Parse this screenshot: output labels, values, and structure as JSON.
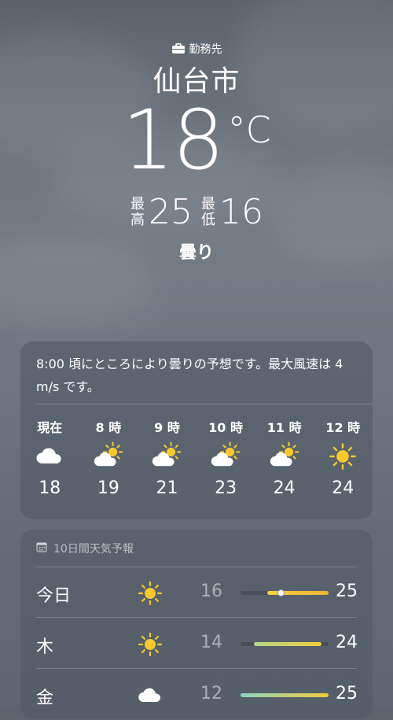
{
  "location": {
    "tag_icon": "briefcase-icon",
    "tag": "勤務先",
    "city": "仙台市",
    "temperature": "18",
    "unit": "°C",
    "high_label": "最高",
    "high": "25",
    "low_label": "最低",
    "low": "16",
    "condition": "曇り"
  },
  "hourly": {
    "summary": "8:00 頃にところにより曇りの予想です。最大風速は 4 m/s です。",
    "hours": [
      {
        "time": "現在",
        "icon": "cloud-icon",
        "temp": "18"
      },
      {
        "time": "8 時",
        "icon": "partly-sunny-icon",
        "temp": "19"
      },
      {
        "time": "9 時",
        "icon": "partly-sunny-icon",
        "temp": "21"
      },
      {
        "time": "10 時",
        "icon": "partly-sunny-icon",
        "temp": "23"
      },
      {
        "time": "11 時",
        "icon": "partly-sunny-icon",
        "temp": "24"
      },
      {
        "time": "12 時",
        "icon": "sun-icon",
        "temp": "24"
      }
    ]
  },
  "daily": {
    "header_icon": "calendar-icon",
    "header": "10日間天気予報",
    "range_min": 12,
    "range_max": 25,
    "days": [
      {
        "day": "今日",
        "icon": "sun-icon",
        "low": "16",
        "high": "25",
        "current": 18,
        "colors": [
          "#f5d23a",
          "#f0b33a"
        ]
      },
      {
        "day": "木",
        "icon": "sun-icon",
        "low": "14",
        "high": "24",
        "colors": [
          "#b7d58a",
          "#f2cc3a"
        ]
      },
      {
        "day": "金",
        "icon": "cloud-icon",
        "low": "12",
        "high": "25",
        "colors": [
          "#8ad6c0",
          "#f2cc3a"
        ]
      }
    ]
  },
  "colors": {
    "sun": "#f7c92e",
    "card": "#505a66",
    "background": "#6b747d"
  }
}
